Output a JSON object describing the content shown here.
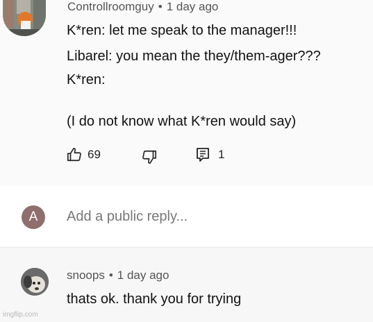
{
  "comment": {
    "username": "Controllroomguy",
    "separator": "•",
    "timestamp": "1 day ago",
    "lines": [
      "K*ren: let me speak to the manager!!!",
      "Libarel: you mean the they/them-ager???",
      "K*ren:",
      "(I do not know what K*ren would say)"
    ],
    "likes": "69",
    "replies_count": "1",
    "icons": {
      "like": "thumbs-up-icon",
      "dislike": "thumbs-down-icon",
      "reply": "reply-icon"
    }
  },
  "reply_box": {
    "avatar_letter": "A",
    "placeholder": "Add a public reply..."
  },
  "reply": {
    "username": "snoops",
    "separator": "•",
    "timestamp": "1 day ago",
    "text": "thats ok. thank you for trying"
  },
  "watermark": "imgflip.com",
  "colors": {
    "avatar_letter_bg": "#8e6f6b",
    "text": "#111111",
    "meta": "#555555"
  }
}
